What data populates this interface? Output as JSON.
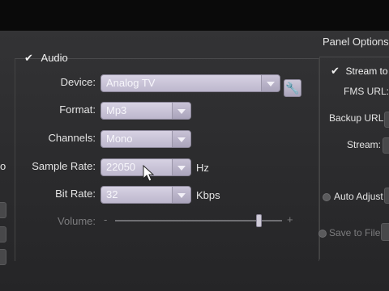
{
  "panel_options_label": "Panel Options:",
  "audio": {
    "checkbox_mark": "✔",
    "label": "Audio"
  },
  "fields": {
    "device": {
      "label": "Device:",
      "value": "Analog TV"
    },
    "format": {
      "label": "Format:",
      "value": "Mp3"
    },
    "channels": {
      "label": "Channels:",
      "value": "Mono"
    },
    "sample_rate": {
      "label": "Sample Rate:",
      "value": "22050",
      "unit": "Hz"
    },
    "bit_rate": {
      "label": "Bit Rate:",
      "value": "32",
      "unit": "Kbps"
    }
  },
  "volume": {
    "label": "Volume:",
    "minus": "-",
    "plus": "+",
    "level": 0.86
  },
  "right_panel": {
    "stream_to": {
      "checkbox_mark": "✔",
      "label": "Stream to"
    },
    "fms_url": "FMS URL:",
    "backup_url": "Backup URL:",
    "stream": "Stream:",
    "auto_adjust": "Auto Adjust",
    "save_to_file": "Save to File"
  },
  "left_edge_glyph": "o",
  "icons": {
    "wrench": "wrench-icon",
    "dropdown": "chevron-down-icon",
    "cursor": "mouse-pointer-icon"
  }
}
